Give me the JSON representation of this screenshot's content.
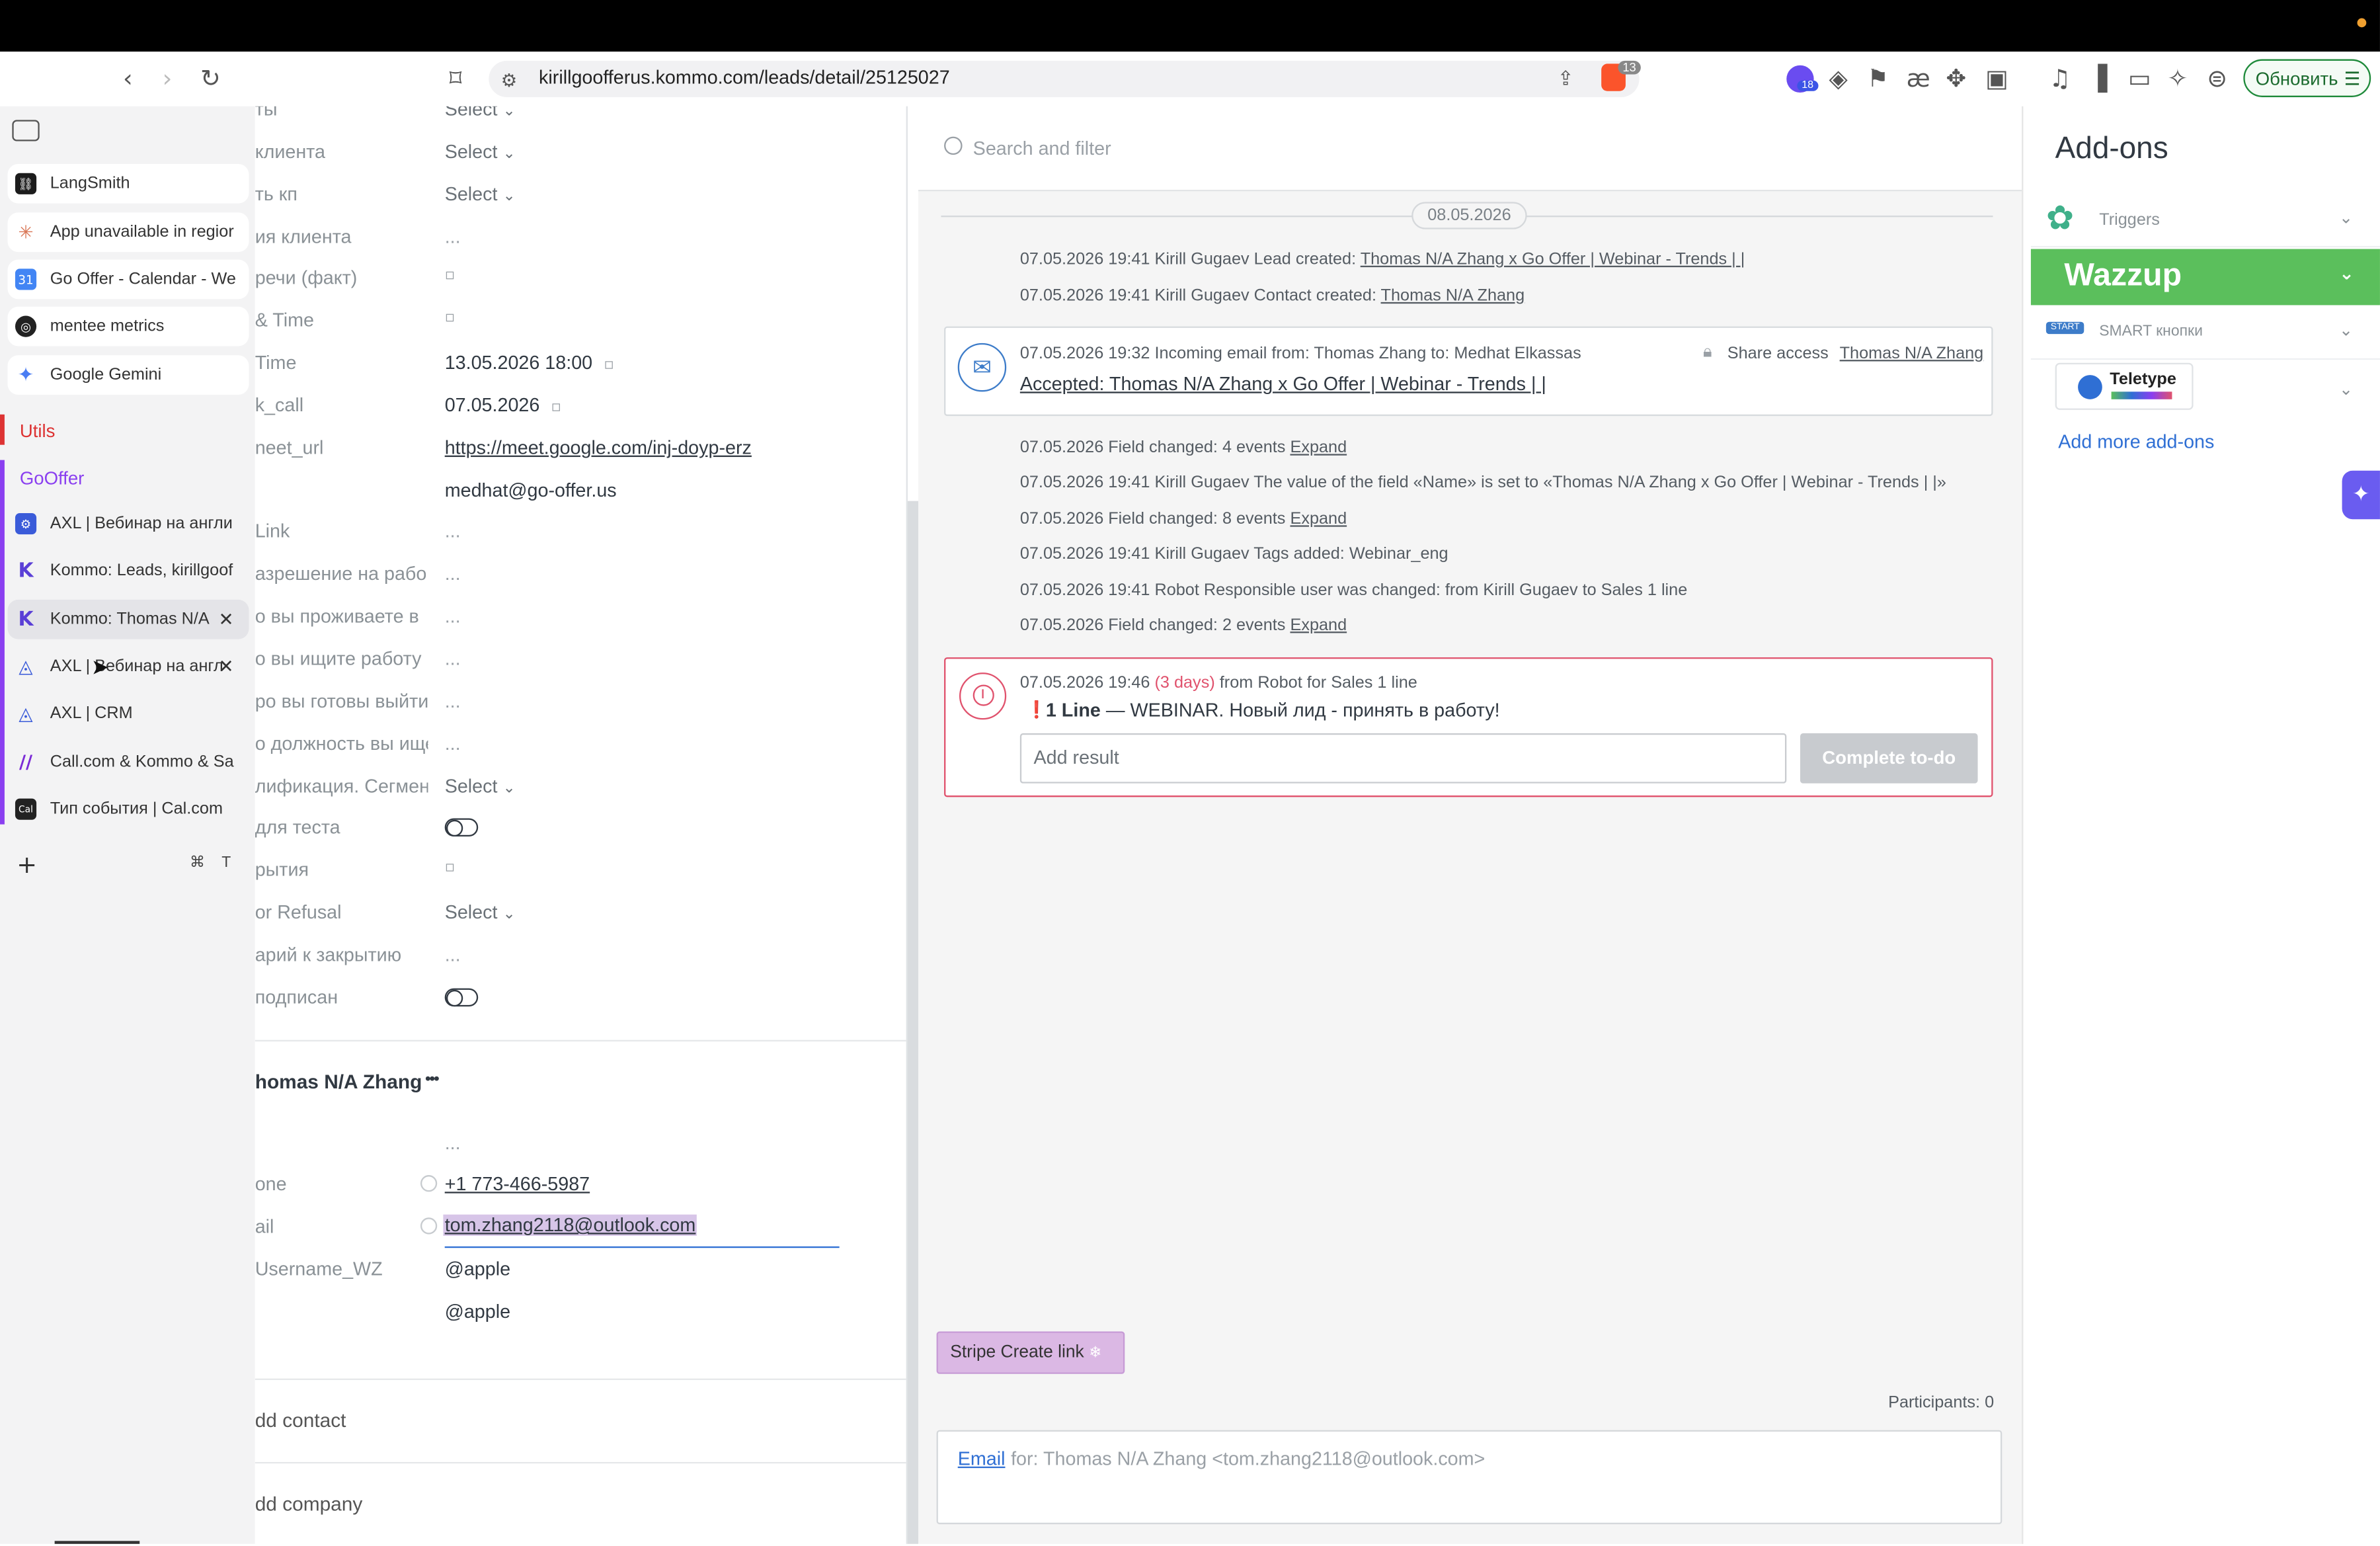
{
  "browser": {
    "url": "kirillgoofferus.kommo.com/leads/detail/25125027",
    "notification_badge": "18",
    "brave_badge": "13",
    "update_button": "Обновить"
  },
  "sidebar": {
    "tabs_top": [
      {
        "label": "LangSmith",
        "icon": "langsmith-icon",
        "color": "#1c1c1c"
      },
      {
        "label": "App unavailable in regior",
        "icon": "claude-icon",
        "color": "#d97757"
      },
      {
        "label": "Go Offer - Calendar - We",
        "icon": "calendar-icon",
        "color": "#4285f4"
      },
      {
        "label": "mentee metrics",
        "icon": "openai-icon",
        "color": "#222222"
      },
      {
        "label": "Google Gemini",
        "icon": "gemini-icon",
        "color": "#4a7df3"
      }
    ],
    "group_utils": "Utils",
    "group_gooffer": "GoOffer",
    "tabs_group": [
      {
        "label": "AXL | Вебинар на англи",
        "icon": "gear-icon",
        "color": "#3a5bd9"
      },
      {
        "label": "Kommo: Leads, kirillgoof",
        "icon": "kommo-icon",
        "color": "#5a3fd6"
      },
      {
        "label": "Kommo: Thomas N/A",
        "icon": "kommo-icon",
        "color": "#5a3fd6"
      },
      {
        "label": "AXL | Вебинар на англ",
        "icon": "triangle-icon",
        "color": "#3a5bd9"
      },
      {
        "label": "AXL | CRM",
        "icon": "triangle-icon",
        "color": "#3a5bd9"
      },
      {
        "label": "Call.com & Kommo & Sa",
        "icon": "make-icon",
        "color": "#7b2ad6"
      },
      {
        "label": "Тип события | Cal.com",
        "icon": "cal-icon",
        "color": "#222222"
      }
    ],
    "shortcut_cmd": "⌘",
    "shortcut_key": "T"
  },
  "lead": {
    "fields": [
      {
        "label": "ты",
        "value": "Select",
        "type": "select"
      },
      {
        "label": "клиента",
        "value": "Select",
        "type": "select"
      },
      {
        "label": "ть кп",
        "value": "Select",
        "type": "select"
      },
      {
        "label": "ия клиента",
        "value": "...",
        "type": "dim"
      },
      {
        "label": "речи (факт)",
        "value": "▫",
        "type": "date"
      },
      {
        "label": "& Time",
        "value": "▫",
        "type": "date"
      },
      {
        "label": "Time",
        "value": "13.05.2026 18:00",
        "type": "datetime"
      },
      {
        "label": "k_call",
        "value": "07.05.2026",
        "type": "datetime"
      },
      {
        "label": "neet_url",
        "value": "https://meet.google.com/inj-doyp-erz",
        "type": "link"
      },
      {
        "label": "",
        "value": "medhat@go-offer.us",
        "type": "text"
      },
      {
        "label": "Link",
        "value": "...",
        "type": "dim"
      },
      {
        "label": "азрешение на рабо",
        "value": "...",
        "type": "dim"
      },
      {
        "label": "о вы проживаете в",
        "value": "...",
        "type": "dim"
      },
      {
        "label": "о вы ищите работу",
        "value": "...",
        "type": "dim"
      },
      {
        "label": "ро вы готовы выйти",
        "value": "...",
        "type": "dim"
      },
      {
        "label": "о должность вы ище",
        "value": "...",
        "type": "dim"
      },
      {
        "label": "лификация. Сегмент",
        "value": "Select",
        "type": "select"
      },
      {
        "label": "для теста",
        "value": "",
        "type": "toggle"
      },
      {
        "label": "рытия",
        "value": "▫",
        "type": "date"
      },
      {
        "label": "or Refusal",
        "value": "Select",
        "type": "select"
      },
      {
        "label": "арий к закрытию",
        "value": "...",
        "type": "dim"
      },
      {
        "label": "подписан",
        "value": "",
        "type": "toggle"
      }
    ]
  },
  "contact": {
    "name": "homas N/A Zhang",
    "menu": "•••",
    "first_value": "...",
    "phone_label": "one",
    "phone": "+1 773-466-5987",
    "email_label": "ail",
    "email": "tom.zhang2118@outlook.com",
    "username_label": "Username_WZ",
    "username": "@apple",
    "extra": "@apple",
    "add_contact": "dd contact",
    "add_company": "dd company"
  },
  "feed": {
    "search_placeholder": "Search and filter",
    "date_pill": "08.05.2026",
    "lead_created": "07.05.2026 19:41 Kirill Gugaev Lead created:",
    "lead_created_link": "Thomas N/A Zhang x Go Offer | Webinar - Trends | |",
    "contact_created": "07.05.2026 19:41 Kirill Gugaev Contact created:",
    "contact_created_link": "Thomas N/A Zhang",
    "email_card": {
      "header": "07.05.2026 19:32 Incoming email from: Thomas Zhang to: Medhat Elkassas",
      "share": "Share access",
      "contact_link": "Thomas N/A Zhang",
      "subject": "Accepted: Thomas N/A Zhang x Go Offer | Webinar - Trends | |"
    },
    "events": [
      {
        "text": "07.05.2026 Field changed: 4 events",
        "link": "Expand"
      },
      {
        "text": "07.05.2026 19:41 Kirill Gugaev The value of the field «Name» is set to «Thomas N/A Zhang x Go Offer | Webinar - Trends | |»",
        "link": ""
      },
      {
        "text": "07.05.2026 Field changed: 8 events",
        "link": "Expand"
      },
      {
        "text": "07.05.2026 19:41 Kirill Gugaev Tags added: Webinar_eng",
        "link": ""
      },
      {
        "text": "07.05.2026 19:41 Robot Responsible user was changed: from Kirill Gugaev to Sales 1 line",
        "link": ""
      },
      {
        "text": "07.05.2026 Field changed: 2 events",
        "link": "Expand"
      }
    ],
    "todo": {
      "time": "07.05.2026 19:46",
      "overdue": "(3 days)",
      "from": "from Robot for Sales 1 line",
      "title_bold": "1 Line",
      "title_rest": "— WEBINAR. Новый лид - принять в работу!",
      "result_placeholder": "Add result",
      "complete_button": "Complete to-do"
    },
    "stripe_button": "Stripe Create link",
    "participants": "Participants: 0",
    "composer_email": "Email",
    "composer_for": "for: Thomas N/A Zhang <tom.zhang2118@outlook.com>"
  },
  "addons": {
    "title": "Add-ons",
    "triggers": "Triggers",
    "wazzup": "Wazzup",
    "smart": "SMART кнопки",
    "teletype": "Teletype",
    "add_more": "Add more add-ons",
    "wazzup_color": "#5bbf5c"
  }
}
